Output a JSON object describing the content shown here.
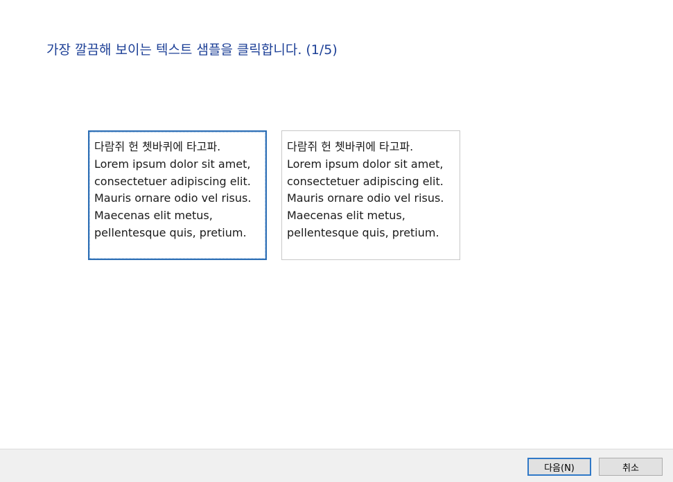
{
  "dialog": {
    "instruction": "가장 깔끔해 보이는 텍스트 샘플을 클릭합니다. (1/5)"
  },
  "samples": [
    {
      "text": "다람쥐 헌 쳇바퀴에 타고파.\nLorem ipsum dolor sit amet,\nconsectetuer adipiscing elit.\nMauris ornare odio vel risus.\nMaecenas elit metus,\npellentesque quis, pretium.",
      "selected": true
    },
    {
      "text": "다람쥐 헌 쳇바퀴에 타고파.\nLorem ipsum dolor sit amet,\nconsectetuer adipiscing elit.\nMauris ornare odio vel risus.\nMaecenas elit metus,\npellentesque quis, pretium.",
      "selected": false
    }
  ],
  "footer": {
    "next_label": "다음(N)",
    "cancel_label": "취소"
  },
  "colors": {
    "instruction_text": "#1c3f96",
    "selected_border": "#2e6fb5",
    "footer_background": "#f0f0f0"
  }
}
